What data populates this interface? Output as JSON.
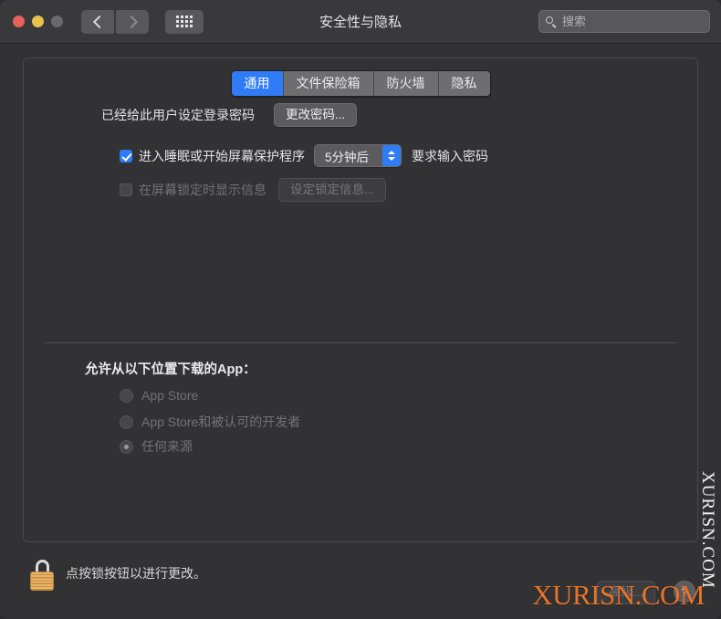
{
  "window": {
    "title": "安全性与隐私",
    "traffic_lights": [
      "close",
      "minimize",
      "zoom"
    ],
    "nav_back_icon": "chevron-left-icon",
    "nav_forward_icon": "chevron-right-icon",
    "grid_icon": "show-all-grid-icon"
  },
  "search": {
    "placeholder": "搜索",
    "value": "",
    "icon": "search-icon"
  },
  "tabs": [
    {
      "label": "通用",
      "active": true
    },
    {
      "label": "文件保险箱",
      "active": false
    },
    {
      "label": "防火墙",
      "active": false
    },
    {
      "label": "隐私",
      "active": false
    }
  ],
  "general": {
    "login_password_label": "已经给此用户设定登录密码",
    "change_password_button": "更改密码...",
    "require_password_checkbox_label": "进入睡眠或开始屏幕保护程序",
    "require_password_checked": true,
    "delay_popup_value": "5分钟后",
    "require_password_suffix": "要求输入密码",
    "lock_message_checkbox_label": "在屏幕锁定时显示信息",
    "lock_message_checked": false,
    "lock_message_button": "设定锁定信息...",
    "download_section_title": "允许从以下位置下载的App：",
    "download_options": [
      {
        "label": "App Store",
        "selected": false
      },
      {
        "label": "App Store和被认可的开发者",
        "selected": false
      },
      {
        "label": "任何来源",
        "selected": true
      }
    ]
  },
  "footer": {
    "lock_icon": "padlock-locked-icon",
    "lock_message": "点按锁按钮以进行更改。",
    "advanced_button": "高级...",
    "help_button": "?"
  },
  "watermark": {
    "vertical": "XURISN.COM",
    "horizontal": "XURISN.COM"
  },
  "colors": {
    "accent": "#2f7cf6",
    "window_bg": "#323234",
    "titlebar_bg": "#39393b",
    "watermark_orange": "#e8742a"
  }
}
